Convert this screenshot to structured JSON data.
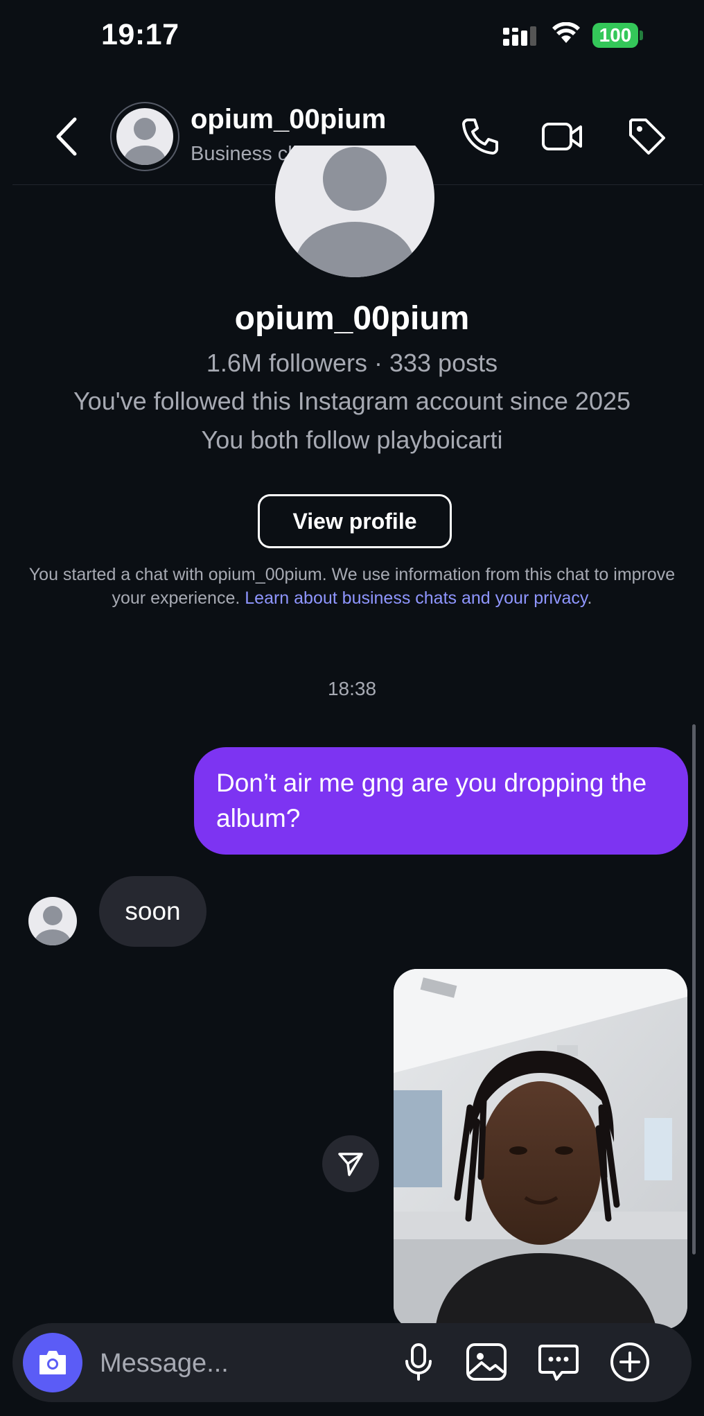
{
  "status_bar": {
    "time": "19:17",
    "battery": "100",
    "icons": [
      "signal-icon",
      "wifi-icon",
      "battery-icon"
    ]
  },
  "header": {
    "name": "opium_00pium",
    "subtitle": "Business chat",
    "icons": [
      "back-chevron-icon",
      "phone-icon",
      "video-camera-icon",
      "tag-icon"
    ]
  },
  "profile": {
    "name": "opium_00pium",
    "stats": "1.6M followers · 333 posts",
    "followed_since": "You've followed this Instagram account since 2025",
    "mutual": "You both follow playboicarti",
    "view_profile_label": "View profile"
  },
  "disclaimer": {
    "text": "You started a chat with opium_00pium. We use information from this chat to improve your experience. ",
    "link": "Learn about business chats and your privacy",
    "end": "."
  },
  "timestamp": "18:38",
  "messages": [
    {
      "direction": "outgoing",
      "text": "Don’t air me gng are you dropping the album?"
    },
    {
      "direction": "incoming",
      "text": "soon"
    },
    {
      "direction": "incoming",
      "type": "photo"
    }
  ],
  "composer": {
    "placeholder": "Message...",
    "icons": [
      "camera-icon",
      "microphone-icon",
      "gallery-icon",
      "sticker-chat-icon",
      "add-circle-icon"
    ]
  },
  "colors": {
    "background": "#0b0f14",
    "outgoing_bubble": "#7d34f2",
    "incoming_bubble": "#262830",
    "link": "#8f96ff",
    "camera_button": "#5b5cf6",
    "battery": "#34c759"
  }
}
